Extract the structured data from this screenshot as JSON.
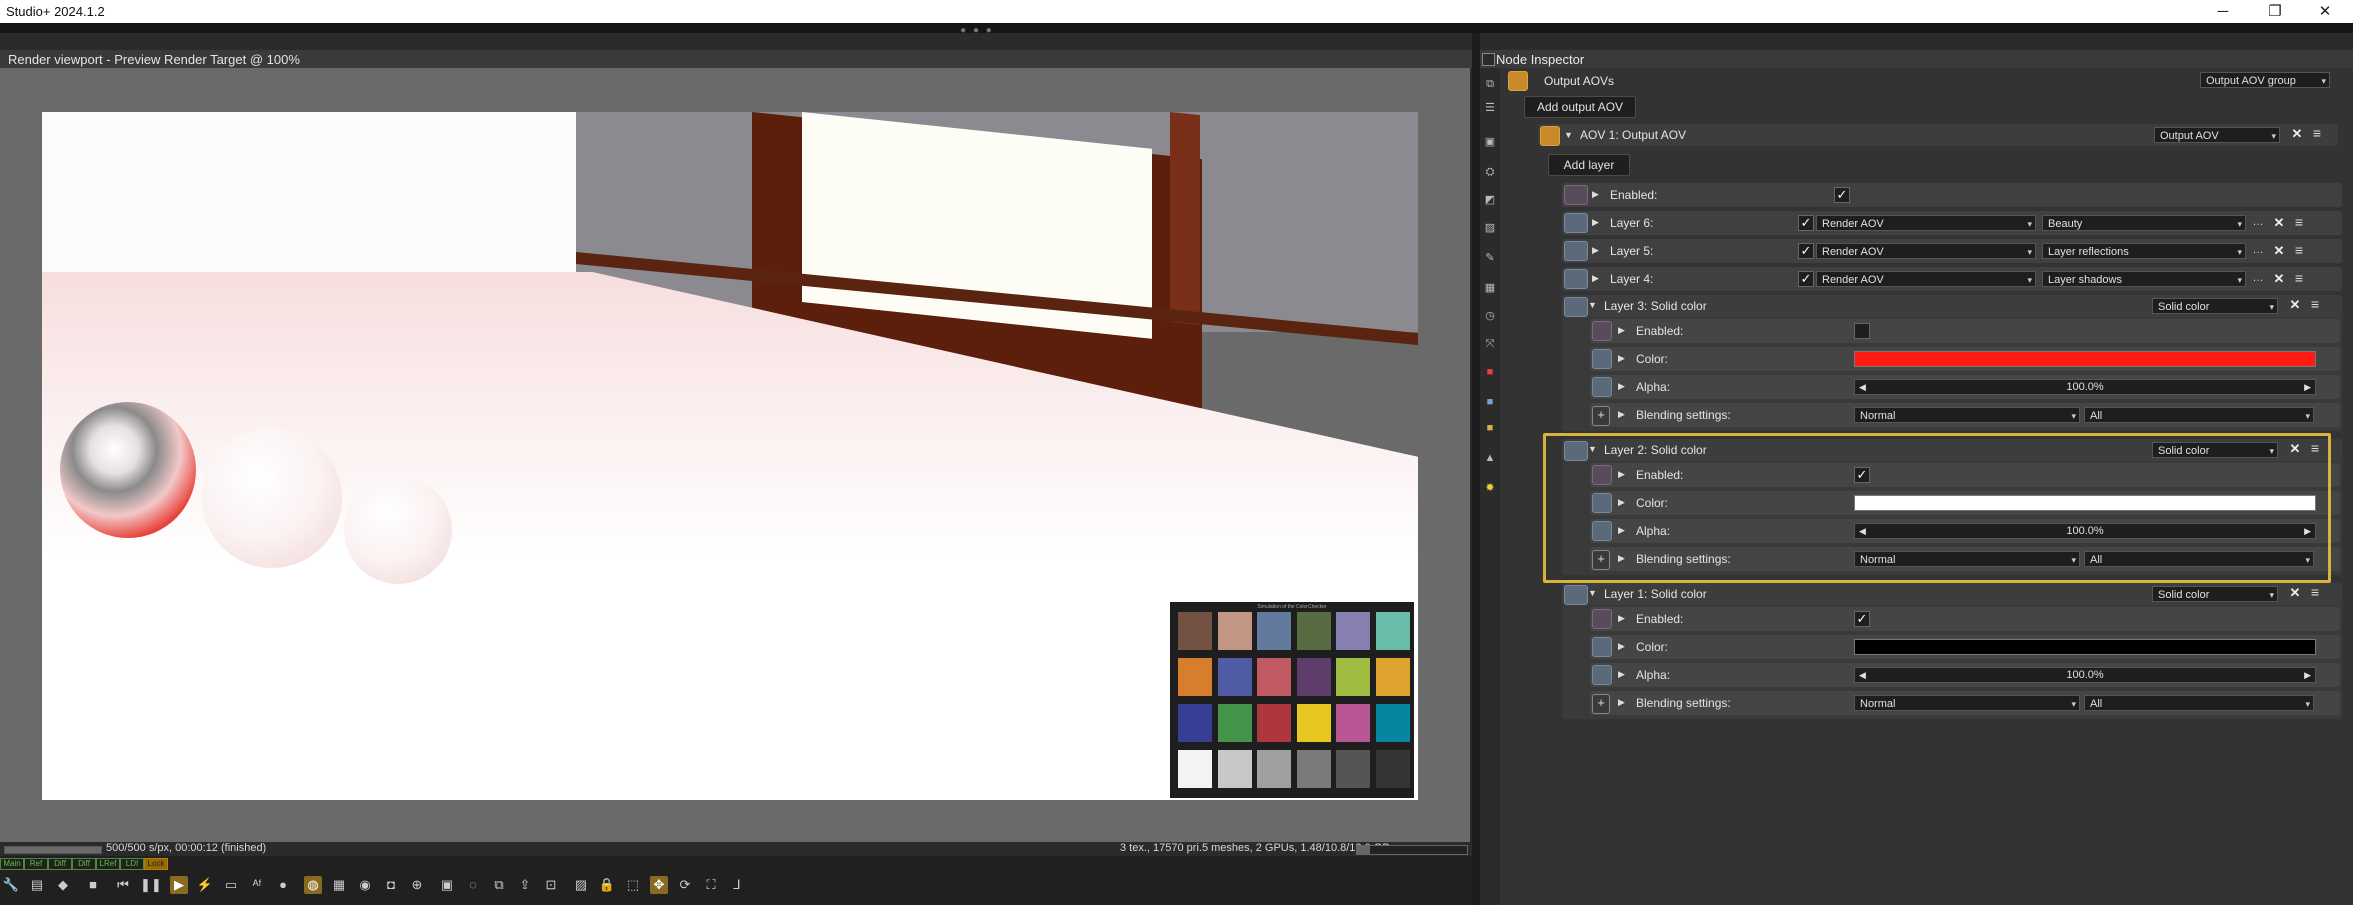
{
  "window": {
    "title": "Studio+ 2024.1.2",
    "minimize": "─",
    "maximize": "❐",
    "close": "✕",
    "grip": "● ● ●"
  },
  "viewport": {
    "header": "Render viewport - Preview Render Target @ 100%",
    "progress_fraction": 1.0,
    "progress_text": "500/500 s/px, 00:00:12 (finished)",
    "stats_text": "3 tex., 17570 pri.5 meshes, 2 GPUs, 1.48/10.8/12.0 GB",
    "memory_fraction": 0.12,
    "checker_caption": "Simulation of the ColorChecker",
    "checker_colors": [
      "#735244",
      "#c29682",
      "#627a9d",
      "#576c43",
      "#8580b1",
      "#67bdaa",
      "#d67e2c",
      "#505ba6",
      "#c15a63",
      "#5e3c6c",
      "#9dbc40",
      "#e0a32e",
      "#383d96",
      "#469449",
      "#af363c",
      "#e7c71f",
      "#bb5695",
      "#0885a1",
      "#f3f3f2",
      "#c8c8c8",
      "#a0a0a0",
      "#7a7a79",
      "#555555",
      "#343434"
    ],
    "tabs": [
      "Main",
      "Ref",
      "Diff",
      "Diff",
      "LRef",
      "LDI",
      "Lock"
    ],
    "toolbar_icons": [
      "spanner-icon",
      "stats-icon",
      "cube-icon",
      "stop-icon",
      "rewind-icon",
      "pause-icon",
      "play-icon",
      "flash-icon",
      "monitor-icon",
      "af-icon",
      "sphere-icon",
      "render-icon",
      "layers-icon",
      "clay-icon",
      "crop-icon",
      "zoom-icon",
      "region-icon",
      "picker-icon",
      "copy-icon",
      "export-icon",
      "camera-icon",
      "image-icon",
      "lock-icon",
      "box-icon",
      "move-icon",
      "orbit-icon",
      "fullscreen-icon",
      "axes-icon"
    ]
  },
  "inspector": {
    "header": "Node Inspector",
    "node_title": "Output AOVs",
    "node_type": "Output AOV group",
    "add_output_aov": "Add output AOV",
    "aov1": {
      "title": "AOV 1: Output AOV",
      "type": "Output AOV",
      "add_layer": "Add layer"
    },
    "enabled_label": "Enabled:",
    "layers_simple": [
      {
        "title": "Layer 6:",
        "type": "Render AOV",
        "pass": "Beauty"
      },
      {
        "title": "Layer 5:",
        "type": "Render AOV",
        "pass": "Layer reflections"
      },
      {
        "title": "Layer 4:",
        "type": "Render AOV",
        "pass": "Layer shadows"
      }
    ],
    "solid_layers": [
      {
        "title": "Layer 3: Solid color",
        "type": "Solid color",
        "enabled": false,
        "color": "#ff1a12",
        "alpha": "100.0%",
        "blend": "Normal",
        "channels": "All"
      },
      {
        "title": "Layer 2: Solid color",
        "type": "Solid color",
        "enabled": true,
        "color": "#ffffff",
        "alpha": "100.0%",
        "blend": "Normal",
        "channels": "All"
      },
      {
        "title": "Layer 1: Solid color",
        "type": "Solid color",
        "enabled": true,
        "color": "#000000",
        "alpha": "100.0%",
        "blend": "Normal",
        "channels": "All"
      }
    ],
    "labels": {
      "enabled": "Enabled:",
      "color": "Color:",
      "alpha": "Alpha:",
      "blending": "Blending settings:"
    },
    "highlight_color": "#d8b43a"
  }
}
